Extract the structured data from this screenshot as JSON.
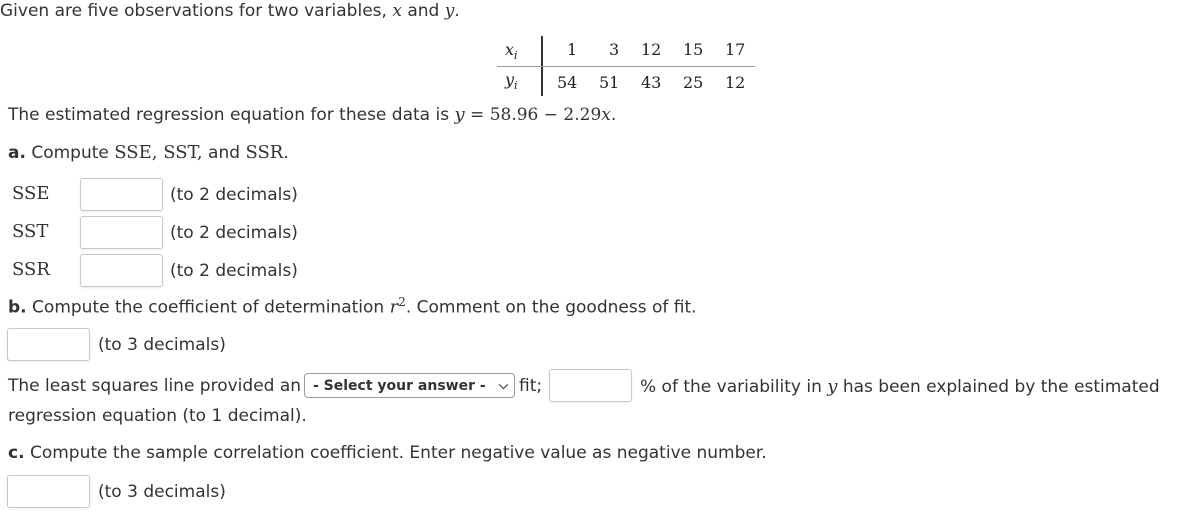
{
  "intro": {
    "text": "Given are five observations for two variables, ",
    "var_x": "x",
    "and": " and ",
    "var_y": "y",
    "end": "."
  },
  "data_table": {
    "x_label": "x",
    "x_sub": "i",
    "y_label": "y",
    "y_sub": "i",
    "x_values": [
      "1",
      "3",
      "12",
      "15",
      "17"
    ],
    "y_values": [
      "54",
      "51",
      "43",
      "25",
      "12"
    ]
  },
  "regression": {
    "text": "The estimated regression equation for these data is ",
    "lhs": "y",
    "eq": " = 58.96 − 2.29",
    "var": "x",
    "end": "."
  },
  "part_a": {
    "label": "a.",
    "text": " Compute ",
    "terms": "SSE, SST,",
    "and": " and ",
    "last": "SSR",
    "end": ".",
    "fields": [
      {
        "label": "SSE",
        "value": "",
        "hint": "(to 2 decimals)"
      },
      {
        "label": "SST",
        "value": "",
        "hint": "(to 2 decimals)"
      },
      {
        "label": "SSR",
        "value": "",
        "hint": "(to 2 decimals)"
      }
    ]
  },
  "part_b": {
    "label": "b.",
    "text": " Compute the coefficient of determination ",
    "r": "r",
    "sup": "2",
    "text2": ". Comment on the goodness of fit.",
    "r2_value": "",
    "r2_hint": "(to 3 decimals)",
    "sentence_start": "The least squares line provided an",
    "select_value": "- Select your answer -",
    "fit_text": "fit;",
    "percent_value": "",
    "percent_text": "% of the variability in ",
    "percent_var": "y",
    "percent_text2": " has been explained by the estimated",
    "line2": "regression equation (to 1 decimal)."
  },
  "part_c": {
    "label": "c.",
    "text": " Compute the sample correlation coefficient. Enter negative value as negative number.",
    "value": "",
    "hint": "(to 3 decimals)"
  }
}
